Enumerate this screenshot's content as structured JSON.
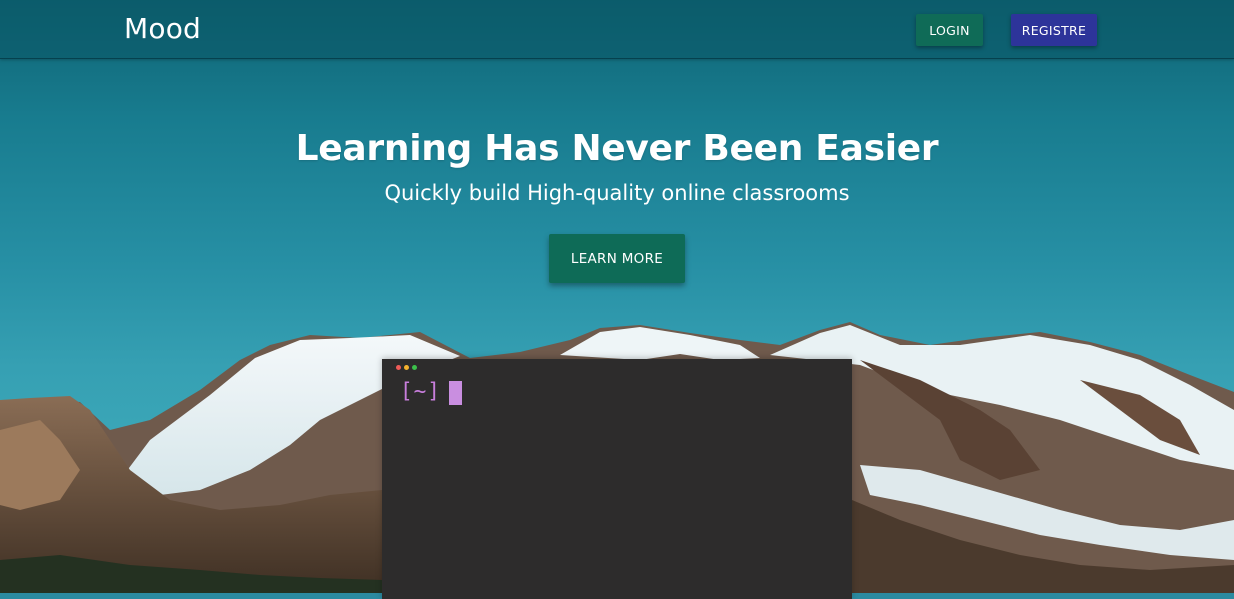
{
  "app": {
    "brand": "Mood"
  },
  "nav": {
    "login_label": "LOGIN",
    "register_label": "REGISTRE"
  },
  "hero": {
    "title": "Learning Has Never Been Easier",
    "subtitle": "Quickly build High-quality online classrooms",
    "cta_label": "LEARN MORE"
  },
  "terminal": {
    "prompt": "[~]"
  },
  "colors": {
    "navbar": "#0b5564",
    "login_button": "#0f6b57",
    "register_button": "#2d349a",
    "cta_button": "#0e6b57",
    "terminal_bg": "#2d2c2c",
    "prompt": "#c87edc"
  },
  "icons": [
    "window-close-dot",
    "window-minimize-dot",
    "window-maximize-dot"
  ]
}
